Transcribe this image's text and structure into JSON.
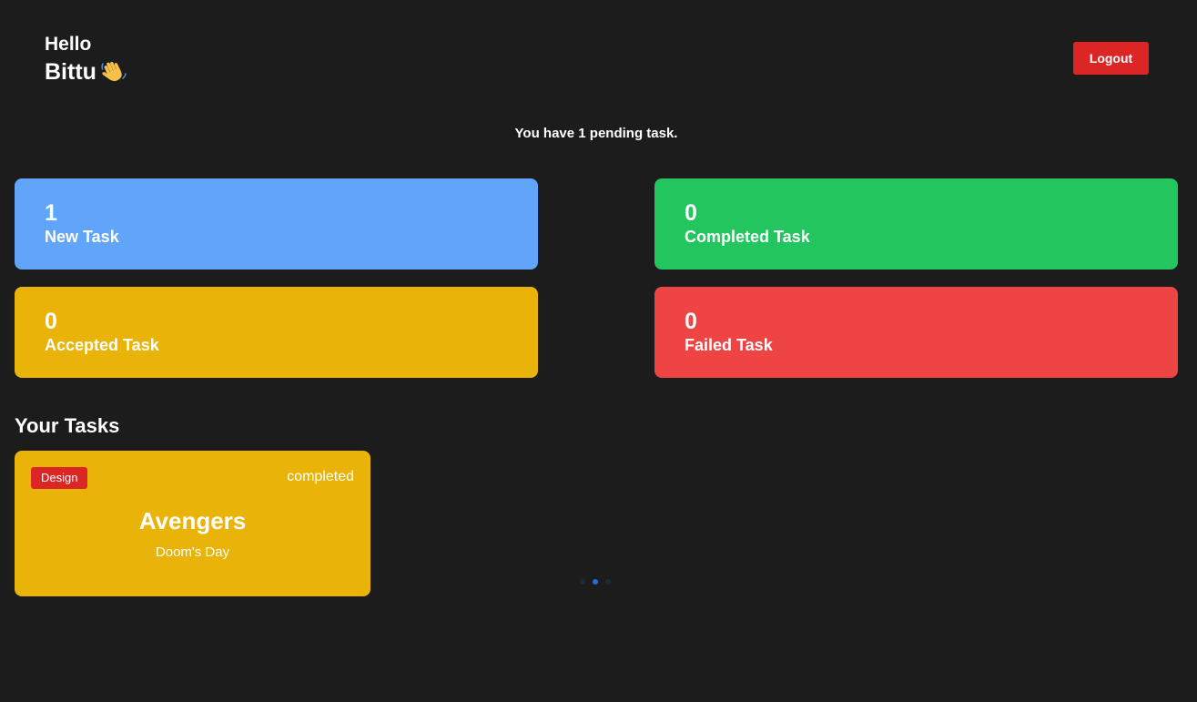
{
  "header": {
    "greeting": "Hello",
    "user_name": "Bittu",
    "wave_icon": "waving-hand-icon",
    "logout_label": "Logout"
  },
  "summary": {
    "pending_message": "You have 1 pending task."
  },
  "stats": {
    "new": {
      "count": "1",
      "label": "New Task",
      "color": "#60a5fa"
    },
    "completed": {
      "count": "0",
      "label": "Completed Task",
      "color": "#22c55e"
    },
    "accepted": {
      "count": "0",
      "label": "Accepted Task",
      "color": "#eab308"
    },
    "failed": {
      "count": "0",
      "label": "Failed Task",
      "color": "#ef4444"
    }
  },
  "tasks_section": {
    "title": "Your Tasks",
    "tasks": [
      {
        "category": "Design",
        "status": "completed",
        "title": "Avengers",
        "description": "Doom's Day",
        "card_color": "#eab308",
        "tag_color": "#dc2626"
      }
    ]
  },
  "colors": {
    "background": "#1c1c1c",
    "logout": "#dc2626",
    "loader_dot": "#1e6fd9"
  }
}
